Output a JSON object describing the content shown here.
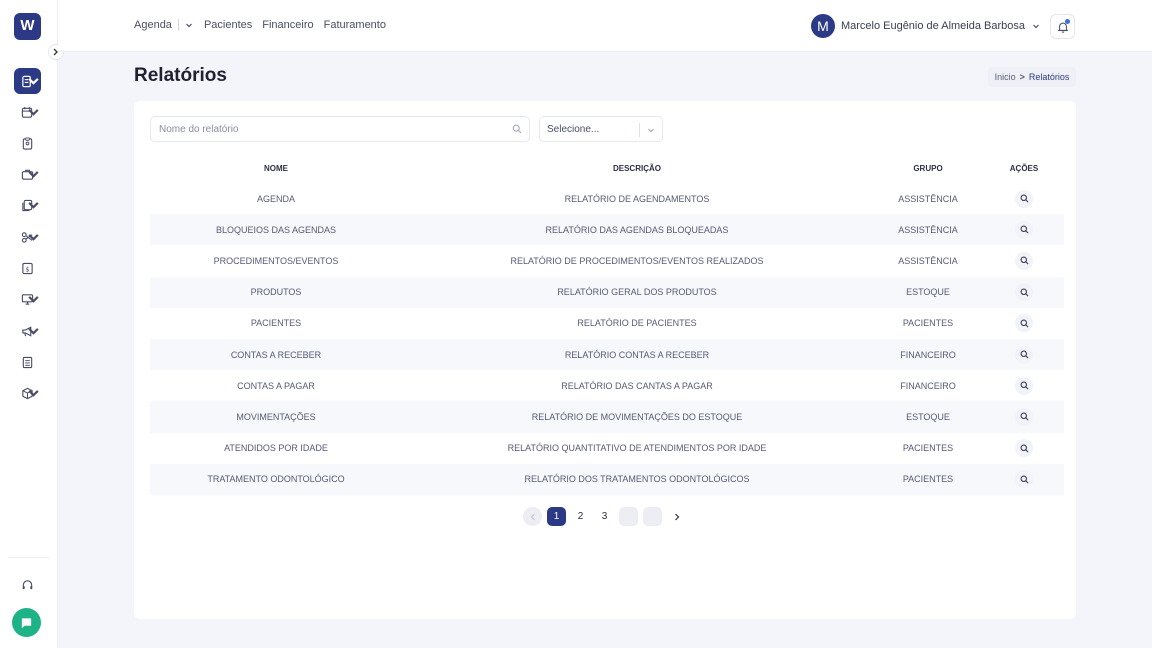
{
  "app": {
    "logo_letter": "W"
  },
  "nav": {
    "items": [
      "Agenda",
      "Pacientes",
      "Financeiro",
      "Faturamento"
    ]
  },
  "user": {
    "initial": "M",
    "name": "Marcelo Eugênio de Almeida Barbosa"
  },
  "page": {
    "title": "Relatórios"
  },
  "breadcrumb": {
    "home": "Inicio",
    "separator": ">",
    "current": "Relatórios"
  },
  "filters": {
    "search_placeholder": "Nome do relatório",
    "group_select_value": "Selecione..."
  },
  "table": {
    "headers": {
      "nome": "NOME",
      "descricao": "DESCRIÇÃO",
      "grupo": "GRUPO",
      "acoes": "AÇÕES"
    },
    "rows": [
      {
        "nome": "AGENDA",
        "descricao": "RELATÓRIO DE AGENDAMENTOS",
        "grupo": "ASSISTÊNCIA"
      },
      {
        "nome": "BLOQUEIOS DAS AGENDAS",
        "descricao": "RELATÓRIO DAS AGENDAS BLOQUEADAS",
        "grupo": "ASSISTÊNCIA"
      },
      {
        "nome": "PROCEDIMENTOS/EVENTOS",
        "descricao": "RELATÓRIO DE PROCEDIMENTOS/EVENTOS REALIZADOS",
        "grupo": "ASSISTÊNCIA"
      },
      {
        "nome": "PRODUTOS",
        "descricao": "RELATÓRIO GERAL DOS PRODUTOS",
        "grupo": "ESTOQUE"
      },
      {
        "nome": "PACIENTES",
        "descricao": "RELATÓRIO DE PACIENTES",
        "grupo": "PACIENTES"
      },
      {
        "nome": "CONTAS A RECEBER",
        "descricao": "RELATÓRIO CONTAS A RECEBER",
        "grupo": "FINANCEIRO"
      },
      {
        "nome": "CONTAS A PAGAR",
        "descricao": "RELATÓRIO DAS CANTAS A PAGAR",
        "grupo": "FINANCEIRO"
      },
      {
        "nome": "MOVIMENTAÇÕES",
        "descricao": "RELATÓRIO DE MOVIMENTAÇÕES DO ESTOQUE",
        "grupo": "ESTOQUE"
      },
      {
        "nome": "ATENDIDOS POR IDADE",
        "descricao": "RELATÓRIO QUANTITATIVO DE ATENDIMENTOS POR IDADE",
        "grupo": "PACIENTES"
      },
      {
        "nome": "TRATAMENTO ODONTOLÓGICO",
        "descricao": "RELATÓRIO DOS TRATAMENTOS ODONTOLÓGICOS",
        "grupo": "PACIENTES"
      }
    ]
  },
  "pagination": {
    "pages": [
      "1",
      "2",
      "3"
    ],
    "current": "1"
  },
  "colors": {
    "primary": "#2c3a86",
    "chat": "#1db387",
    "notification_dot": "#3d6de0"
  }
}
